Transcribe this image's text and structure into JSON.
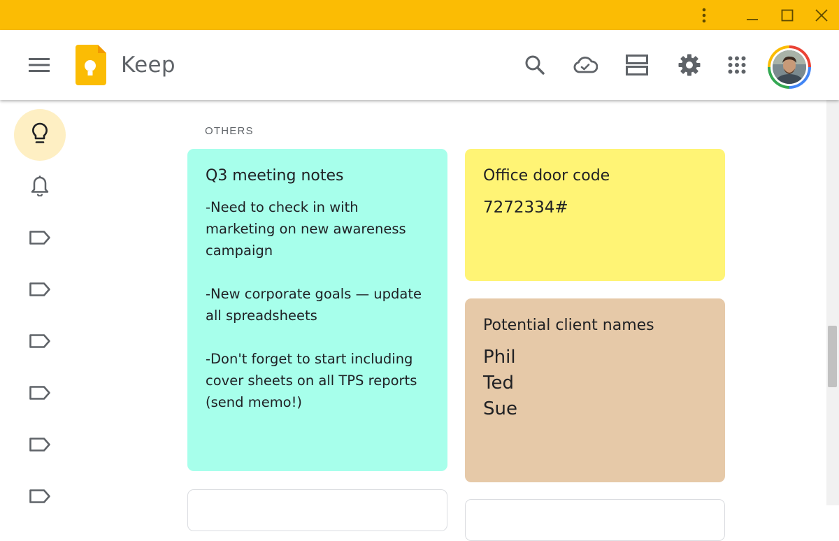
{
  "window": {
    "titlebar_color": "#fbbc04",
    "controls": [
      "more-vert-icon",
      "minimize-icon",
      "maximize-icon",
      "close-icon"
    ]
  },
  "header": {
    "menu_icon": "hamburger-menu-icon",
    "logo_icon": "keep-logo-icon",
    "app_title": "Keep",
    "actions": [
      "search-icon",
      "cloud-sync-icon",
      "list-view-icon",
      "settings-gear-icon",
      "apps-grid-icon"
    ],
    "avatar": "user-avatar"
  },
  "sidebar": {
    "items": [
      {
        "icon": "lightbulb-icon",
        "active": true
      },
      {
        "icon": "bell-icon",
        "active": false
      },
      {
        "icon": "label-icon",
        "active": false
      },
      {
        "icon": "label-icon",
        "active": false
      },
      {
        "icon": "label-icon",
        "active": false
      },
      {
        "icon": "label-icon",
        "active": false
      },
      {
        "icon": "label-icon",
        "active": false
      },
      {
        "icon": "label-icon",
        "active": false
      }
    ]
  },
  "main": {
    "section_label": "OTHERS",
    "notes": [
      {
        "title": "Q3 meeting notes",
        "body": "-Need to check in with\nmarketing on new awareness\ncampaign\n\n-New corporate goals — update\nall spreadsheets\n\n-Don't forget to start including\ncover sheets on all TPS reports\n(send memo!)",
        "color": "#a7ffeb"
      },
      {
        "title": "Office door code",
        "body": "7272334#",
        "color": "#fff475"
      },
      {
        "title": "Potential client names",
        "body": "Phil\nTed\nSue",
        "color": "#e6c9a8"
      }
    ]
  },
  "colors": {
    "accent": "#fbbc04",
    "active_nav": "#feefc3",
    "icon": "#5f6368"
  }
}
